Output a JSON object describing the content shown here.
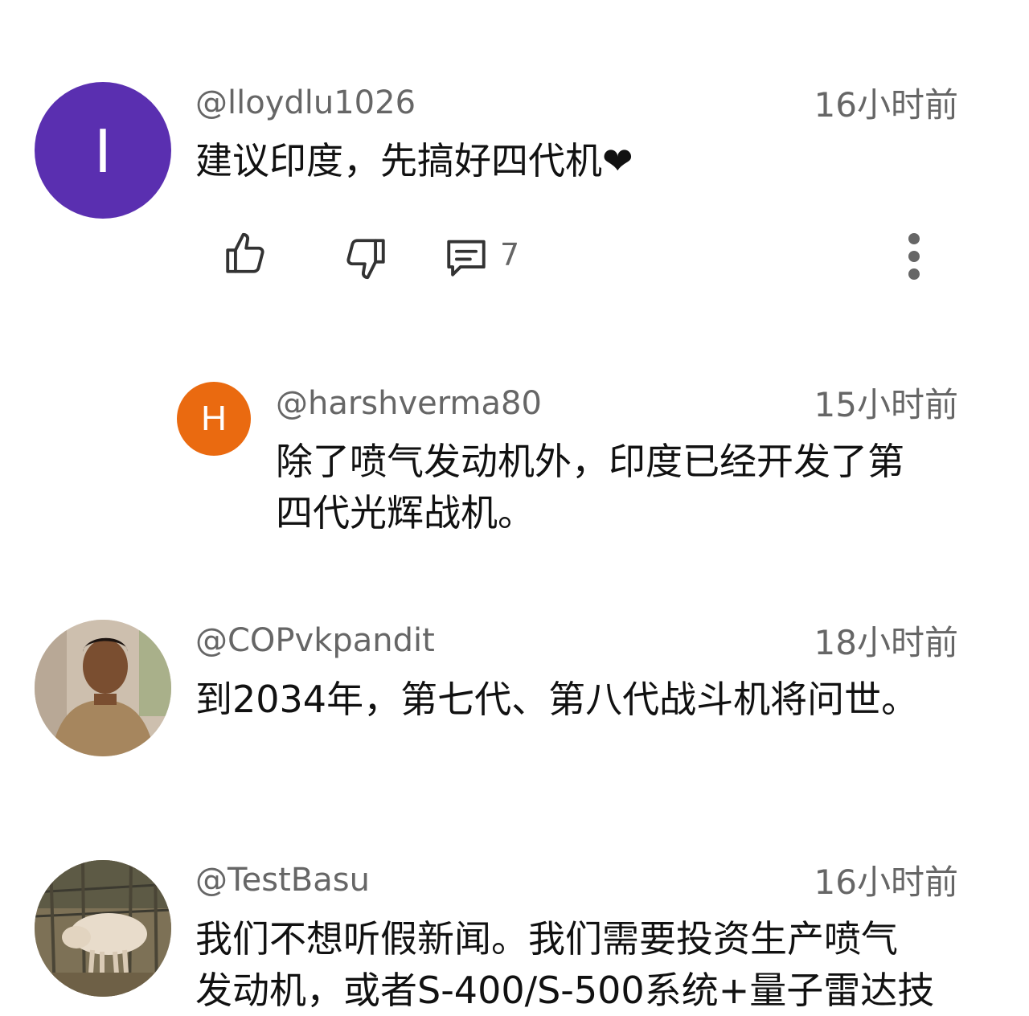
{
  "comments": [
    {
      "avatar_letter": "I",
      "avatar_color": "#5a2fb0",
      "handle": "@lloydlu1026",
      "time": "16小时前",
      "text": "建议印度，先搞好四代机❤",
      "reply_count": "7"
    },
    {
      "avatar_letter": "H",
      "avatar_color": "#ea6a10",
      "handle": "@harshverma80",
      "time": "15小时前",
      "text_line1": "除了喷气发动机外，印度已经开发了第",
      "text_line2": "四代光辉战机。"
    },
    {
      "handle": "@COPvkpandit",
      "time": "18小时前",
      "text": "到2034年，第七代、第八代战斗机将问世。"
    },
    {
      "handle": "@TestBasu",
      "time": "16小时前",
      "text_line1": "我们不想听假新闻。我们需要投资生产喷气",
      "text_line2": "发动机，或者S-400/S-500系统+量子雷达技"
    }
  ]
}
